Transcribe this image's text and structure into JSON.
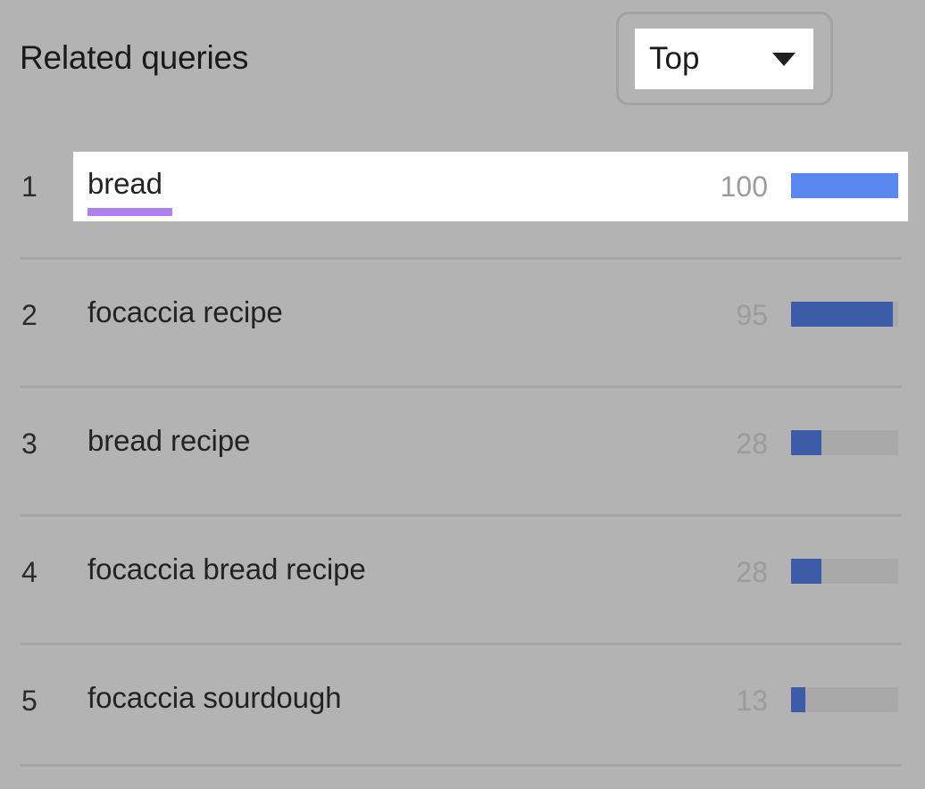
{
  "header": {
    "title": "Related queries",
    "sort_dropdown": {
      "name": "sort-select",
      "selected": "Top",
      "caret_icon": "chevron-down-icon"
    }
  },
  "colors": {
    "background": "#b3b3b3",
    "row_highlight": "#ffffff",
    "bar_fill": "#3c5ca8",
    "bar_fill_active": "#5b88ec",
    "bar_track": "#a9a9a9",
    "value_text": "#9b9b9b",
    "query_text": "#232323",
    "underline": "#b07ef0",
    "divider": "#a5a5a5"
  },
  "chart_data": {
    "type": "bar",
    "title": "Related queries",
    "xlabel": "",
    "ylabel": "",
    "ylim": [
      0,
      100
    ],
    "categories": [
      "bread",
      "focaccia recipe",
      "bread recipe",
      "focaccia bread recipe",
      "focaccia sourdough"
    ],
    "values": [
      100,
      95,
      28,
      28,
      13
    ],
    "ranks": [
      1,
      2,
      3,
      4,
      5
    ],
    "orientation": "horizontal",
    "grid": false,
    "legend": false
  },
  "rows": [
    {
      "rank": "1",
      "query": "bread",
      "value": "100",
      "pct": 100,
      "active": true,
      "underlined": true
    },
    {
      "rank": "2",
      "query": "focaccia recipe",
      "value": "95",
      "pct": 95,
      "active": false,
      "underlined": false
    },
    {
      "rank": "3",
      "query": "bread recipe",
      "value": "28",
      "pct": 28,
      "active": false,
      "underlined": false
    },
    {
      "rank": "4",
      "query": "focaccia bread recipe",
      "value": "28",
      "pct": 28,
      "active": false,
      "underlined": false
    },
    {
      "rank": "5",
      "query": "focaccia sourdough",
      "value": "13",
      "pct": 13,
      "active": false,
      "underlined": false
    }
  ]
}
